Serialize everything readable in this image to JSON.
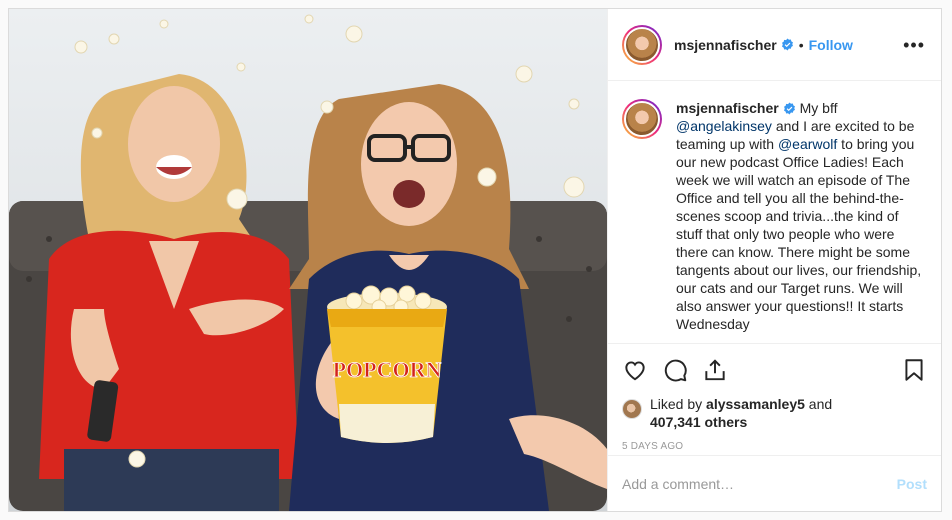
{
  "post": {
    "username": "msjennafischer",
    "follow_label": "Follow",
    "dot": "•",
    "more_label": "•••",
    "caption": {
      "username": "msjennafischer",
      "part1": " My bff ",
      "mention1": "@angelakinsey",
      "part2": " and I are excited to be teaming up with ",
      "mention2": "@earwolf",
      "part3": " to bring you our new podcast Office Ladies! Each week we will watch an episode of The Office and tell you all the behind-the-scenes scoop and trivia...the kind of stuff that only two people who were there can know. There might be some tangents about our lives, our friendship, our cats and our Target runs. We will also answer your questions!! It starts Wednesday"
    },
    "likes": {
      "prefix": "Liked by ",
      "liker": "alyssamanley5",
      "and": " and",
      "count": "407,341 others"
    },
    "timestamp": "5 DAYS AGO",
    "comment_placeholder": "Add a comment…",
    "post_button": "Post",
    "popcorn_label": "POPCORN"
  },
  "colors": {
    "accent": "#3897f0",
    "mention": "#003569",
    "post_disabled": "#b2dffc",
    "red_shirt": "#d8261e",
    "navy_shirt": "#1f2c5b"
  },
  "icons": [
    "verified-badge-icon",
    "heart-icon",
    "comment-icon",
    "share-icon",
    "bookmark-icon",
    "more-options-icon"
  ]
}
